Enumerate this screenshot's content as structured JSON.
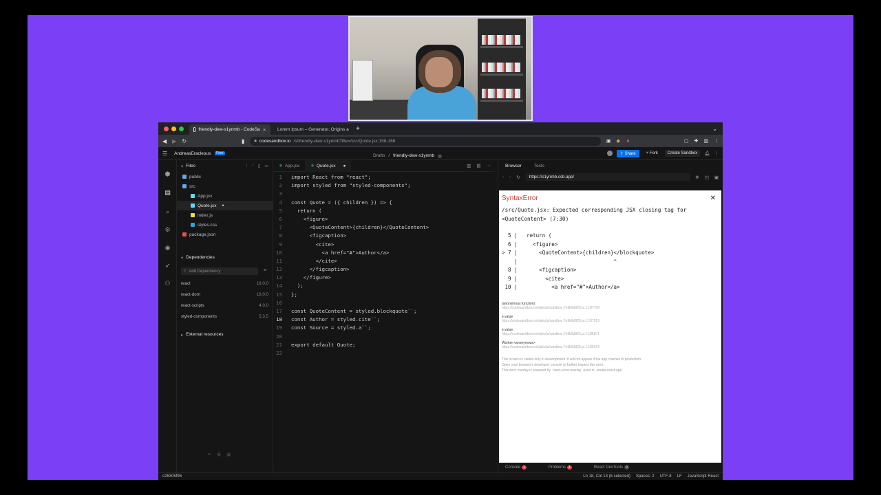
{
  "browser": {
    "tabs": [
      {
        "title": "friendly-dew-s1ynmb - CodeSa",
        "active": true
      },
      {
        "title": "Lorem Ipsum – Generator, Origins a",
        "active": false
      }
    ],
    "url_host": "codesandbox.io",
    "url_path": "/s/friendly-dew-s1ynmb?file=/src/Quote.jsx:158-168"
  },
  "header": {
    "user": "AndreasEracleous",
    "badge": "Free",
    "breadcrumb_parent": "Drafts",
    "breadcrumb_sep": "/",
    "sandbox_name": "friendly-dew-s1ynmb",
    "share": "Share",
    "fork": "Fork",
    "create": "Create Sandbox"
  },
  "sidebar": {
    "files_title": "Files",
    "files": [
      {
        "name": "public",
        "icon": "folder-icon",
        "indent": 0
      },
      {
        "name": "src",
        "icon": "folder-icon",
        "indent": 0
      },
      {
        "name": "App.jsx",
        "icon": "react-icon",
        "indent": 1
      },
      {
        "name": "Quote.jsx",
        "icon": "react-icon",
        "indent": 1,
        "active": true
      },
      {
        "name": "index.js",
        "icon": "js-icon",
        "indent": 1
      },
      {
        "name": "styles.css",
        "icon": "css-icon",
        "indent": 1
      },
      {
        "name": "package.json",
        "icon": "npm-icon",
        "indent": 0
      }
    ],
    "deps_title": "Dependencies",
    "deps_placeholder": "Add Dependency",
    "deps": [
      {
        "name": "react",
        "version": "18.0.0"
      },
      {
        "name": "react-dom",
        "version": "18.0.0"
      },
      {
        "name": "react-scripts",
        "version": "4.0.0"
      },
      {
        "name": "styled-components",
        "version": "5.3.5"
      }
    ],
    "external_title": "External resources"
  },
  "editor": {
    "tabs": [
      {
        "name": "App.jsx",
        "active": false
      },
      {
        "name": "Quote.jsx",
        "active": true
      }
    ],
    "lines": [
      "import React from \"react\";",
      "import styled from \"styled-components\";",
      "",
      "const Quote = ({ children }) => {",
      "  return (",
      "    <figure>",
      "      <QuoteContent>{children}</QuoteContent>",
      "      <figcaption>",
      "        <cite>",
      "          <a href=\"#\">Author</a>",
      "        </cite>",
      "      </figcaption>",
      "    </figure>",
      "  );",
      "};",
      "",
      "const QuoteContent = styled.blockquote``;",
      "const Author = styled.cite``;",
      "const Source = styled.a``;",
      "",
      "export default Quote;",
      ""
    ],
    "current_line": 18
  },
  "preview": {
    "tabs": [
      "Browser",
      "Tests"
    ],
    "url": "https://s1ynmb.csb.app/",
    "error_title": "SyntaxError",
    "error_message": "/src/Quote.jsx: Expected corresponding JSX closing tag for <QuoteContent> (7:30)",
    "code_frame": [
      "  5 |   return (",
      "  6 |     <figure>",
      "> 7 |       <QuoteContent>{children}</blockquote>",
      "    |                               ^",
      "  8 |       <figcaption>",
      "  9 |         <cite>",
      " 10 |           <a href=\"#\">Author</a>"
    ],
    "stack": [
      {
        "fn": "(anonymous function)",
        "loc": "https://codesandbox.io/static/js/sandbox.7e9b6d925.js:1:187709"
      },
      {
        "fn": "e.value",
        "loc": "https://codesandbox.io/static/js/sandbox.7e9b6d925.js:1:187019"
      },
      {
        "fn": "e.value",
        "loc": "https://codesandbox.io/static/js/sandbox.7e9b6d925.js:1:186871"
      },
      {
        "fn": "Worker.<anonymous>",
        "loc": "https://codesandbox.io/static/js/sandbox.7e9b6d925.js:1:186679"
      }
    ],
    "footer": [
      "This screen is visible only in development. It will not appear if the app crashes in production.",
      "Open your browser's developer console to further inspect this error.",
      "This error overlay is powered by `react-error-overlay` used in `create-react-app`."
    ],
    "bottom_tabs": [
      {
        "label": "Console",
        "count": "1"
      },
      {
        "label": "Problems",
        "count": "1"
      },
      {
        "label": "React DevTools",
        "count": "0"
      }
    ]
  },
  "statusbar": {
    "commit": "c26305f96",
    "position": "Ln 18, Col 13 (6 selected)",
    "spaces": "Spaces: 2",
    "encoding": "UTF-8",
    "eol": "LF",
    "language": "JavaScript React"
  }
}
